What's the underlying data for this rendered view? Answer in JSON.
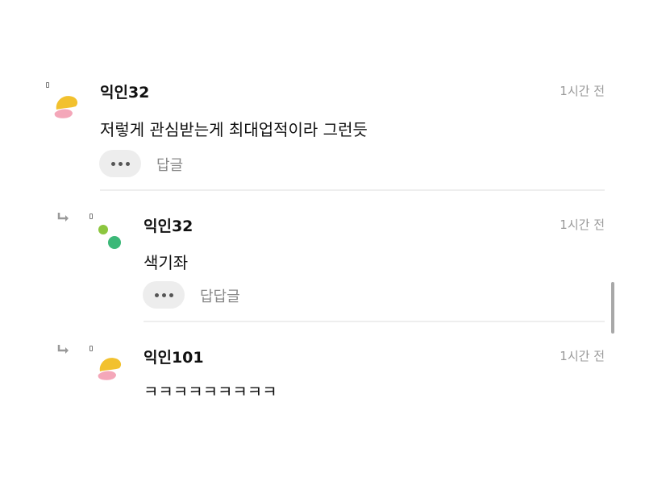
{
  "comments": [
    {
      "author": "익인32",
      "time": "1시간 전",
      "text": "저렇게 관심받는게 최대업적이라 그런듯",
      "reply_label": "답글",
      "avatar_icon": "yellow-pink-blob-avatar"
    },
    {
      "author": "익인32",
      "time": "1시간 전",
      "text": "색기좌",
      "reply_label": "답답글",
      "avatar_icon": "green-dots-avatar"
    },
    {
      "author": "익인101",
      "time": "1시간 전",
      "text": "ㅋㅋㅋㅋㅋㅋㅋㅋㅋ",
      "avatar_icon": "yellow-pink-blob-avatar"
    }
  ],
  "colors": {
    "avatar_yellow": "#f2c12e",
    "avatar_pink": "#f4a7b9",
    "avatar_green_light": "#8cc63f",
    "avatar_green": "#3cb878",
    "time_gray": "#999999",
    "button_bg": "#ededed"
  }
}
